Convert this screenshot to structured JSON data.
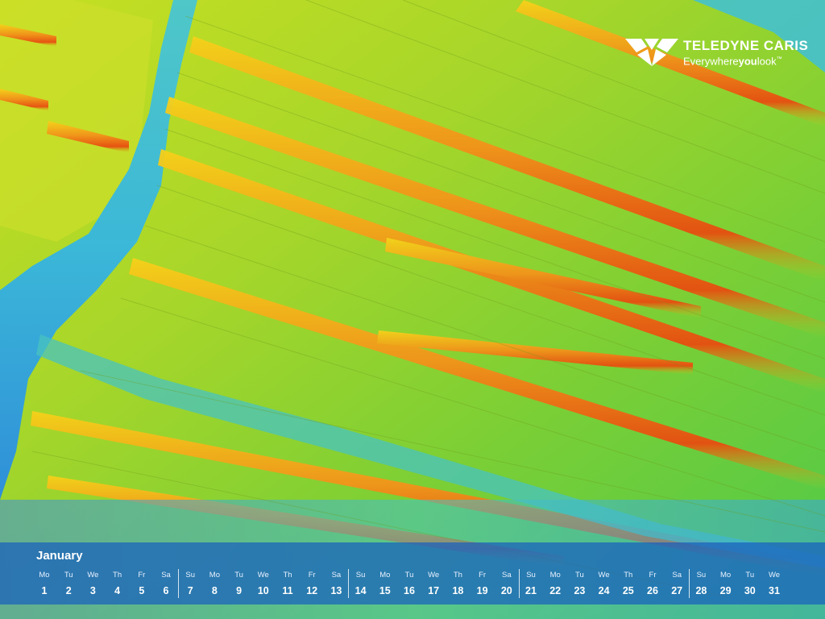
{
  "wallpaper": {
    "type": "multibeam-bathymetry-image",
    "colors": [
      "#2f7fd8",
      "#3fc1d9",
      "#5ccf3a",
      "#b8dc22",
      "#f0c419",
      "#f28a10",
      "#e8420f"
    ]
  },
  "brand": {
    "name": "TELEDYNE CARIS",
    "tagline_prefix": "Everywhere",
    "tagline_bold": "you",
    "tagline_suffix": "look",
    "trademark": "™",
    "icon": "teledyne-logo-mark"
  },
  "calendar": {
    "month": "January",
    "days": [
      {
        "name": "Mo",
        "num": "1"
      },
      {
        "name": "Tu",
        "num": "2"
      },
      {
        "name": "We",
        "num": "3"
      },
      {
        "name": "Th",
        "num": "4"
      },
      {
        "name": "Fr",
        "num": "5"
      },
      {
        "name": "Sa",
        "num": "6"
      },
      {
        "name": "Su",
        "num": "7"
      },
      {
        "name": "Mo",
        "num": "8"
      },
      {
        "name": "Tu",
        "num": "9"
      },
      {
        "name": "We",
        "num": "10"
      },
      {
        "name": "Th",
        "num": "11"
      },
      {
        "name": "Fr",
        "num": "12"
      },
      {
        "name": "Sa",
        "num": "13"
      },
      {
        "name": "Su",
        "num": "14"
      },
      {
        "name": "Mo",
        "num": "15"
      },
      {
        "name": "Tu",
        "num": "16"
      },
      {
        "name": "We",
        "num": "17"
      },
      {
        "name": "Th",
        "num": "18"
      },
      {
        "name": "Fr",
        "num": "19"
      },
      {
        "name": "Sa",
        "num": "20"
      },
      {
        "name": "Su",
        "num": "21"
      },
      {
        "name": "Mo",
        "num": "22"
      },
      {
        "name": "Tu",
        "num": "23"
      },
      {
        "name": "We",
        "num": "24"
      },
      {
        "name": "Th",
        "num": "25"
      },
      {
        "name": "Fr",
        "num": "26"
      },
      {
        "name": "Sa",
        "num": "27"
      },
      {
        "name": "Su",
        "num": "28"
      },
      {
        "name": "Mo",
        "num": "29"
      },
      {
        "name": "Tu",
        "num": "30"
      },
      {
        "name": "We",
        "num": "31"
      }
    ]
  }
}
